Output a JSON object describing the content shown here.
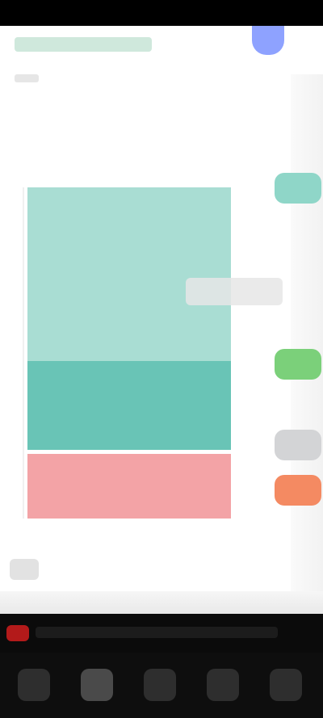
{
  "app": {
    "title": "",
    "subtitle": ""
  },
  "chart": {
    "segments": [
      {
        "name": "",
        "color": "#a9ddd3"
      },
      {
        "name": "",
        "color": "#69c4b6"
      },
      {
        "name": "",
        "color": "#f3a3a6"
      }
    ]
  },
  "right_pills": [
    {
      "color": "#8fd6c8"
    },
    {
      "color": "#7bd07a"
    },
    {
      "color": "#d3d4d6"
    },
    {
      "color": "#f48a62"
    }
  ],
  "bottom_nav": {
    "items": [
      {
        "icon": "nav-icon"
      },
      {
        "icon": "nav-icon"
      },
      {
        "icon": "nav-icon"
      },
      {
        "icon": "nav-icon"
      },
      {
        "icon": "nav-icon"
      }
    ]
  }
}
